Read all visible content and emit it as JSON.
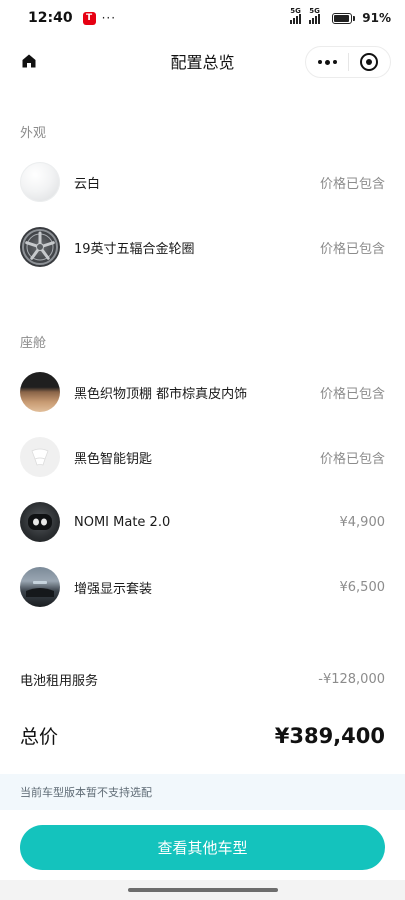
{
  "status_bar": {
    "time": "12:40",
    "app_badge": "T",
    "extra": "···",
    "signal1_label": "5G",
    "signal2_label": "5G",
    "battery_percent": "91%",
    "battery_level": 0.91
  },
  "nav": {
    "title": "配置总览"
  },
  "sections": {
    "exterior": "外观",
    "cabin": "座舱"
  },
  "items": [
    {
      "label": "云白",
      "value": "价格已包含",
      "icon": "white-paint-swatch"
    },
    {
      "label": "19英寸五辐合金轮圈",
      "value": "价格已包含",
      "icon": "wheel-rim"
    },
    {
      "label": "黑色织物顶棚 都市棕真皮内饰",
      "value": "价格已包含",
      "icon": "interior-swatch"
    },
    {
      "label": "黑色智能钥匙",
      "value": "价格已包含",
      "icon": "smart-key"
    },
    {
      "label": "NOMI Mate 2.0",
      "value": "¥4,900",
      "icon": "nomi-robot"
    },
    {
      "label": "增强显示套装",
      "value": "¥6,500",
      "icon": "hud-display"
    }
  ],
  "battery_service": {
    "label": "电池租用服务",
    "value": "-¥128,000"
  },
  "total": {
    "label": "总价",
    "value": "¥389,400"
  },
  "notice": "当前车型版本暂不支持选配",
  "cta_label": "查看其他车型",
  "colors": {
    "accent": "#14c3bd",
    "notice_bg": "#f2f8fc",
    "muted_text": "#8c8c8c"
  }
}
